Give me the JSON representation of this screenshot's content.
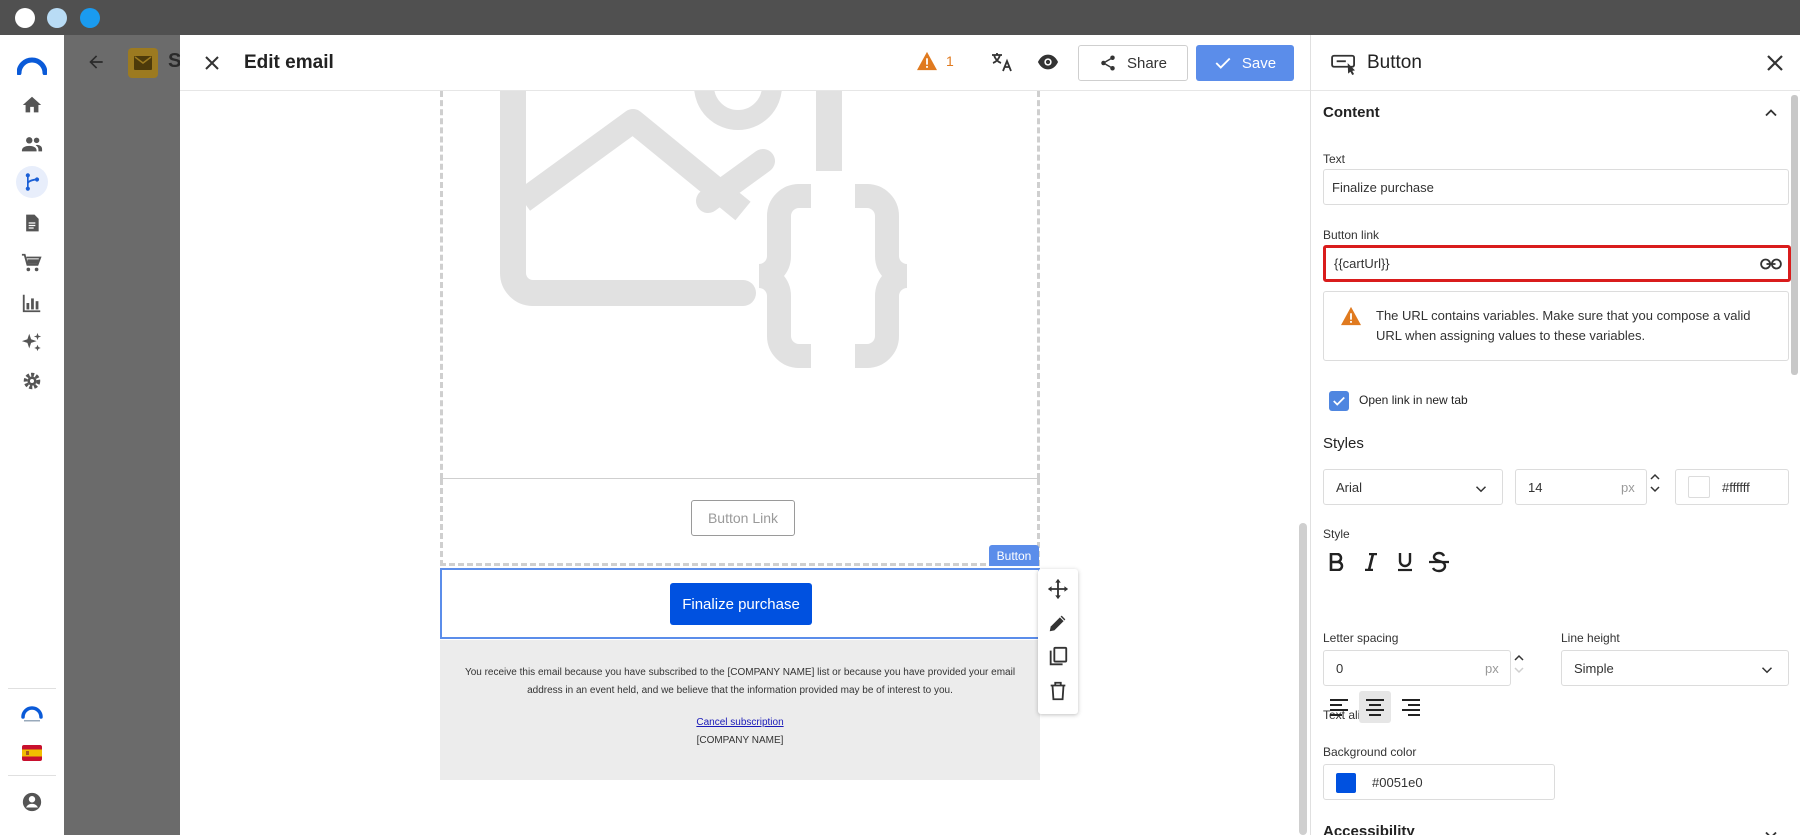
{
  "colors": {
    "accent": "#5b8dea",
    "button_bg": "#0051e0",
    "warning": "#e07a1f",
    "error": "#d91c1c",
    "dot1": "#ffffff",
    "dot2": "#b9dcf5",
    "dot3": "#1a9bf0"
  },
  "app_sidebar": {
    "icons": [
      "logo-icon",
      "home-icon",
      "contacts-icon",
      "automation-icon",
      "content-icon",
      "cart-icon",
      "reports-icon",
      "ai-sparkle-icon",
      "settings-icon",
      "brand-logo-icon",
      "flag-spain-icon",
      "user-icon"
    ]
  },
  "background": {
    "title_initial": "S"
  },
  "editor": {
    "title": "Edit email",
    "warning_count": "1",
    "share_label": "Share",
    "save_label": "Save",
    "email": {
      "ghost_button_label": "Button Link",
      "block_tag": "Button",
      "button_label": "Finalize purchase",
      "footer_text": "You receive this email because you have subscribed to the [COMPANY NAME] list or because you have provided your email address in an event held, and we believe that the information provided may be of interest to you.",
      "footer_link": "Cancel subscription",
      "footer_company": "[COMPANY NAME]"
    }
  },
  "panel": {
    "title": "Button",
    "content_section": "Content",
    "text_label": "Text",
    "text_value": "Finalize purchase",
    "link_label": "Button link",
    "link_value": "{{cartUrl}}",
    "warning_text": "The URL contains variables. Make sure that you compose a valid URL when assigning values to these variables.",
    "open_new_tab_label": "Open link in new tab",
    "open_new_tab_checked": true,
    "styles_section": "Styles",
    "font_family": "Arial",
    "font_size": "14",
    "font_size_unit": "px",
    "text_color": "#ffffff",
    "style_label": "Style",
    "letter_spacing_label": "Letter spacing",
    "letter_spacing_value": "0",
    "letter_spacing_unit": "px",
    "line_height_label": "Line height",
    "line_height_value": "Simple",
    "text_align_label": "Text align",
    "text_align_selected": "center",
    "background_color_label": "Background color",
    "background_color_value": "#0051e0",
    "next_section": "Accessibility"
  }
}
